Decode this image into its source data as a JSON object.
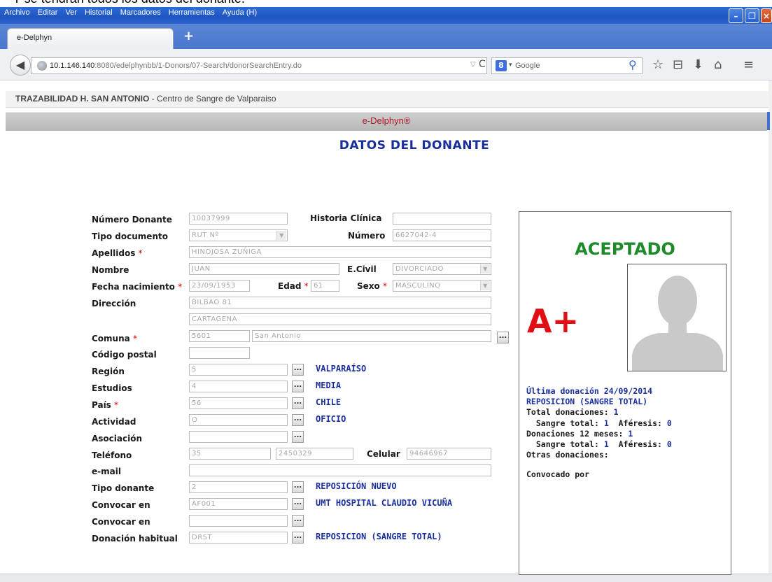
{
  "caption": "Y se tendrán todos los datos del donante.",
  "menu": [
    "Archivo",
    "Editar",
    "Ver",
    "Historial",
    "Marcadores",
    "Herramientas",
    "Ayuda (H)"
  ],
  "tab": {
    "title": "e-Delphyn",
    "new_tab": "+"
  },
  "address": {
    "host": "10.1.146.140",
    "rest": ":8080/edelphynbb/1-Donors/07-Search/donorSearchEntry.do"
  },
  "search": {
    "engine_icon": "8",
    "placeholder": "Google"
  },
  "site": {
    "title_bold": "TRAZABILIDAD H. SAN ANTONIO",
    "title_rest": " - Centro de Sangre de Valparaiso",
    "app_name": "e-Delphyn®"
  },
  "page_heading": "DATOS DEL DONANTE",
  "form": {
    "numero_donante": {
      "label": "Número Donante",
      "value": "10037999"
    },
    "historia_clinica": {
      "label": "Historia Clínica",
      "value": ""
    },
    "tipo_documento": {
      "label": "Tipo documento",
      "value": "RUT Nº"
    },
    "numero": {
      "label": "Número",
      "value": "6627042-4"
    },
    "apellidos": {
      "label": "Apellidos",
      "value": "HINOJOSA ZUÑIGA"
    },
    "nombre": {
      "label": "Nombre",
      "value": "JUAN"
    },
    "ecivil": {
      "label": "E.Civil",
      "value": "DIVORCIADO"
    },
    "fecha_nacimiento": {
      "label": "Fecha nacimiento",
      "value": "23/09/1953"
    },
    "edad": {
      "label": "Edad",
      "value": "61"
    },
    "sexo": {
      "label": "Sexo",
      "value": "MASCULINO"
    },
    "direccion": {
      "label": "Dirección",
      "line1": "BILBAO 81",
      "line2": "CARTAGENA"
    },
    "comuna": {
      "label": "Comuna",
      "code": "5601",
      "name": "San Antonio"
    },
    "codigo_postal": {
      "label": "Código postal",
      "value": ""
    },
    "region": {
      "label": "Región",
      "code": "5",
      "desc": "VALPARAÍSO"
    },
    "estudios": {
      "label": "Estudios",
      "code": "4",
      "desc": "MEDIA"
    },
    "pais": {
      "label": "País",
      "code": "56",
      "desc": "CHILE"
    },
    "actividad": {
      "label": "Actividad",
      "code": "O",
      "desc": "OFICIO"
    },
    "asociacion": {
      "label": "Asociación",
      "code": "",
      "desc": ""
    },
    "telefono": {
      "label": "Teléfono",
      "area": "35",
      "number": "2450329"
    },
    "celular": {
      "label": "Celular",
      "value": "94646967"
    },
    "email": {
      "label": "e-mail",
      "value": ""
    },
    "tipo_donante": {
      "label": "Tipo donante",
      "code": "2",
      "desc": "REPOSICIÓN NUEVO"
    },
    "convocar1": {
      "label": "Convocar en",
      "code": "AF001",
      "desc": "UMT HOSPITAL CLAUDIO VICUÑA"
    },
    "convocar2": {
      "label": "Convocar en",
      "code": "",
      "desc": ""
    },
    "donacion_habitual": {
      "label": "Donación habitual",
      "code": "DRST",
      "desc": "REPOSICION (SANGRE TOTAL)"
    },
    "required_mark": "*",
    "lookup_button": "..."
  },
  "card": {
    "status": "ACEPTADO",
    "blood_type": "A+",
    "ultima_donacion": "Última donación 24/09/2014",
    "ultima_tipo": "REPOSICION (SANGRE TOTAL)",
    "total_label": "Total donaciones:",
    "total": "1",
    "total_sangre_label": "Sangre total:",
    "total_sangre": "1",
    "total_aferesis_label": "Aféresis:",
    "total_aferesis": "0",
    "doce_label": "Donaciones 12 meses:",
    "doce": "1",
    "doce_sangre_label": "Sangre total:",
    "doce_sangre": "1",
    "doce_aferesis_label": "Aféresis:",
    "doce_aferesis": "0",
    "otras": "Otras donaciones:",
    "convocado": "Convocado por"
  }
}
